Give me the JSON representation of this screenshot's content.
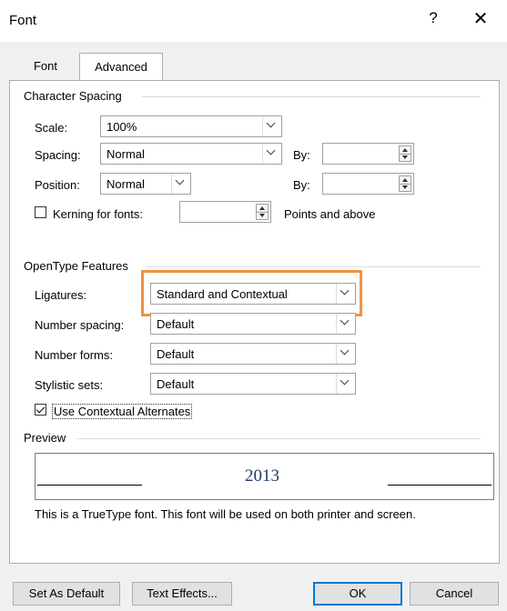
{
  "dialog": {
    "title": "Font",
    "help": "?",
    "close": "✕"
  },
  "tabs": [
    "Font",
    "Advanced"
  ],
  "character_spacing": {
    "title": "Character Spacing",
    "scale": {
      "label": "Scale:",
      "value": "100%"
    },
    "spacing": {
      "label": "Spacing:",
      "value": "Normal",
      "by_label": "By:",
      "by_value": ""
    },
    "position": {
      "label": "Position:",
      "value": "Normal",
      "by_label": "By:",
      "by_value": ""
    },
    "kerning": {
      "label": "Kerning for fonts:",
      "value": "",
      "suffix": "Points and above",
      "checked": false
    }
  },
  "opentype": {
    "title": "OpenType Features",
    "ligatures": {
      "label": "Ligatures:",
      "value": "Standard and Contextual"
    },
    "number_spacing": {
      "label": "Number spacing:",
      "value": "Default"
    },
    "number_forms": {
      "label": "Number forms:",
      "value": "Default"
    },
    "stylistic_sets": {
      "label": "Stylistic sets:",
      "value": "Default"
    },
    "contextual_alternates": {
      "label": "Use Contextual Alternates",
      "checked": true
    }
  },
  "preview": {
    "title": "Preview",
    "sample": "2013",
    "note": "This is a TrueType font. This font will be used on both printer and screen."
  },
  "buttons": {
    "set_default": "Set As Default",
    "text_effects": "Text Effects...",
    "ok": "OK",
    "cancel": "Cancel"
  },
  "colors": {
    "highlight": "#f2923d",
    "ok_border": "#0078d7"
  }
}
